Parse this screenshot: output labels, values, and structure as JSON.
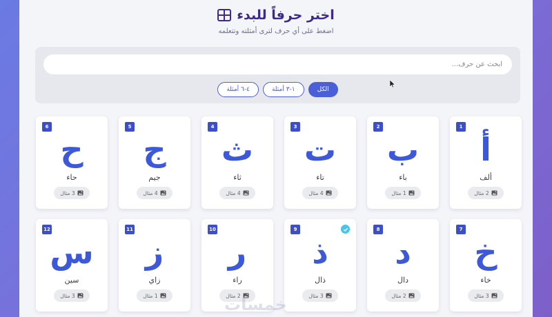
{
  "header": {
    "title": "اختر حرفاً للبدء",
    "icon": "grid-icon",
    "subtitle": "اضغط على أي حرف لترى أمثلته وتتعلمه"
  },
  "search": {
    "placeholder": "ابحث عن حرف..."
  },
  "filters": [
    {
      "label": "الكل",
      "active": true
    },
    {
      "label": "١-٣ أمثلة",
      "active": false
    },
    {
      "label": "٤-٦ أمثلة",
      "active": false
    }
  ],
  "letters": [
    {
      "number": "1",
      "glyph": "أ",
      "name": "ألف",
      "examples": "2 مثال",
      "done": false
    },
    {
      "number": "2",
      "glyph": "ب",
      "name": "باء",
      "examples": "1 مثال",
      "done": false
    },
    {
      "number": "3",
      "glyph": "ت",
      "name": "تاء",
      "examples": "4 مثال",
      "done": false
    },
    {
      "number": "4",
      "glyph": "ث",
      "name": "ثاء",
      "examples": "4 مثال",
      "done": false
    },
    {
      "number": "5",
      "glyph": "ج",
      "name": "جيم",
      "examples": "4 مثال",
      "done": false
    },
    {
      "number": "6",
      "glyph": "ح",
      "name": "حاء",
      "examples": "3 مثال",
      "done": false
    },
    {
      "number": "7",
      "glyph": "خ",
      "name": "خاء",
      "examples": "3 مثال",
      "done": false
    },
    {
      "number": "8",
      "glyph": "د",
      "name": "دال",
      "examples": "2 مثال",
      "done": false
    },
    {
      "number": "9",
      "glyph": "ذ",
      "name": "ذال",
      "examples": "3 مثال",
      "done": true
    },
    {
      "number": "10",
      "glyph": "ر",
      "name": "راء",
      "examples": "2 مثال",
      "done": false
    },
    {
      "number": "11",
      "glyph": "ز",
      "name": "زاي",
      "examples": "1 مثال",
      "done": false
    },
    {
      "number": "12",
      "glyph": "س",
      "name": "سين",
      "examples": "3 مثال",
      "done": false
    }
  ],
  "watermark": "خمسات",
  "colors": {
    "accent": "#4a5fd8",
    "letter": "#3d59d8",
    "check": "#4cc3e8",
    "title": "#3d2a8c"
  }
}
